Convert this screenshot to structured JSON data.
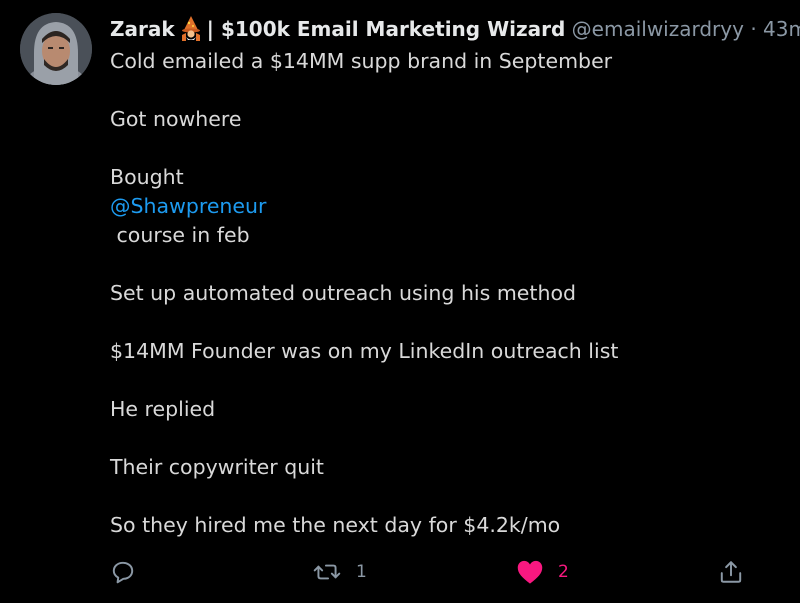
{
  "tweet": {
    "display_name": "Zarak",
    "name_suffix": "| $100k Email Marketing Wizard",
    "handle": "@emailwizardryy",
    "separator": "·",
    "timestamp": "43m",
    "lines": {
      "l1": "Cold emailed a $14MM supp brand in September",
      "l2": "Got nowhere",
      "l3": "Bought",
      "mention": "@Shawpreneur",
      "l4": " course in feb",
      "l5": "Set up automated outreach using his method",
      "l6": "$14MM Founder was on my LinkedIn outreach list",
      "l7": "He replied",
      "l8": "Their copywriter quit",
      "l9": "So they hired me the next day for $4.2k/mo"
    }
  },
  "actions": {
    "reply_icon": "reply-icon",
    "retweet_icon": "retweet-icon",
    "retweet_count": "1",
    "like_icon": "heart-icon",
    "like_count": "2",
    "share_icon": "share-icon"
  },
  "colors": {
    "background": "#000000",
    "text": "#d9d9d9",
    "muted": "#8b98a5",
    "mention": "#1d9bf0",
    "like": "#f91880"
  }
}
